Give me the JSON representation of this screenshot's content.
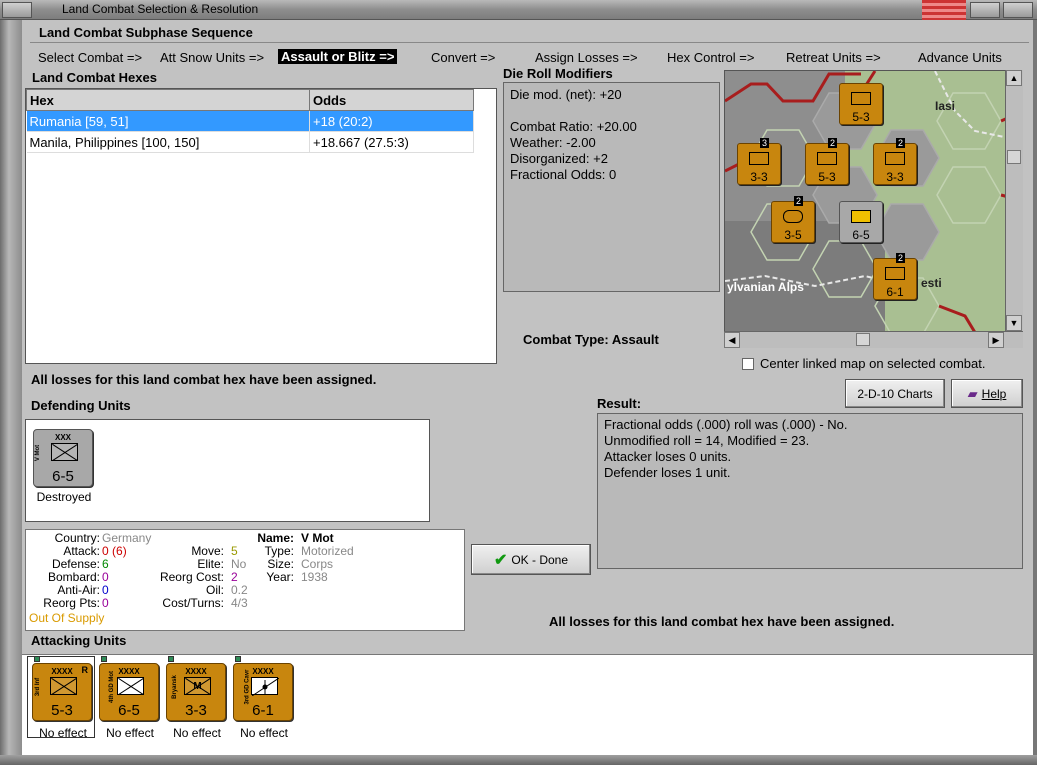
{
  "window": {
    "title": "Land Combat Selection & Resolution"
  },
  "subphase": {
    "heading": "Land Combat Subphase Sequence",
    "steps": [
      {
        "label": "Select Combat =>"
      },
      {
        "label": "Att Snow Units =>"
      },
      {
        "label": "Assault or Blitz =>"
      },
      {
        "label": "Convert =>"
      },
      {
        "label": "Assign Losses =>"
      },
      {
        "label": "Hex Control =>"
      },
      {
        "label": "Retreat Units =>"
      },
      {
        "label": "Advance Units"
      }
    ],
    "active_index": 2
  },
  "hexes": {
    "heading": "Land Combat Hexes",
    "columns": [
      "Hex",
      "Odds"
    ],
    "rows": [
      {
        "hex": "Rumania [59, 51]",
        "odds": "+18 (20:2)",
        "selected": true
      },
      {
        "hex": "Manila, Philippines [100, 150]",
        "odds": "+18.667 (27.5:3)",
        "selected": false
      }
    ]
  },
  "die_roll": {
    "heading": "Die Roll Modifiers",
    "lines": [
      "Die mod. (net): +20",
      "",
      "Combat Ratio: +20.00",
      "Weather: -2.00",
      "Disorganized: +2",
      "Fractional Odds: 0"
    ]
  },
  "combat_type": {
    "label": "Combat Type:",
    "value": "Assault"
  },
  "map": {
    "labels": [
      "Iasi",
      "ylvanian Alps",
      "esti"
    ],
    "counters": [
      {
        "value": "5-3",
        "badge": ""
      },
      {
        "value": "3-3",
        "badge": "3"
      },
      {
        "value": "5-3",
        "badge": "2"
      },
      {
        "value": "3-3",
        "badge": "2"
      },
      {
        "value": "3-5",
        "badge": "2"
      },
      {
        "value": "6-5",
        "badge": ""
      },
      {
        "value": "6-1",
        "badge": "2"
      }
    ],
    "unit_label_xx": "XX",
    "unit_label_xxxx": "XXXX"
  },
  "center_map": {
    "label": "Center linked map on selected combat.",
    "checked": false
  },
  "buttons": {
    "charts": "2-D-10 Charts",
    "help": "Help",
    "done": "OK - Done"
  },
  "status_msg": "All losses for this land combat hex have been assigned.",
  "defending": {
    "heading": "Defending Units",
    "units": [
      {
        "size": "XXX",
        "name": "V Mot",
        "value": "6-5",
        "caption": "Destroyed"
      }
    ]
  },
  "result": {
    "heading": "Result:",
    "lines": [
      "Fractional odds (.000) roll was (.000)  - No.",
      "Unmodified roll = 14, Modified = 23.",
      "Attacker loses 0 units.",
      "Defender loses 1 unit."
    ]
  },
  "unit_info": {
    "country_label": "Country:",
    "country": "Germany",
    "attack_label": "Attack:",
    "attack": "0",
    "attack_paren": "(6)",
    "defense_label": "Defense:",
    "defense": "6",
    "bombard_label": "Bombard:",
    "bombard": "0",
    "antiair_label": "Anti-Air:",
    "antiair": "0",
    "reorg_pts_label": "Reorg Pts:",
    "reorg_pts": "0",
    "supply": "Out Of Supply",
    "move_label": "Move:",
    "move": "5",
    "elite_label": "Elite:",
    "elite": "No",
    "reorg_cost_label": "Reorg Cost:",
    "reorg_cost": "2",
    "oil_label": "Oil:",
    "oil": "0.2",
    "cost_turns_label": "Cost/Turns:",
    "cost_turns": "4/3",
    "name_label": "Name:",
    "name": "V Mot",
    "type_label": "Type:",
    "type": "Motorized",
    "size_label": "Size:",
    "size": "Corps",
    "year_label": "Year:",
    "year": "1938"
  },
  "attacking": {
    "heading": "Attacking Units",
    "units": [
      {
        "size": "XXXX",
        "name": "3rd Inf",
        "value": "5-3",
        "r": "R",
        "symbol": "x",
        "caption": "No effect"
      },
      {
        "size": "XXXX",
        "name": "4th GD Mot",
        "value": "6-5",
        "r": "",
        "symbol": "x",
        "caption": "No effect"
      },
      {
        "size": "XXXX",
        "name": "Bryansk",
        "value": "3-3",
        "r": "",
        "symbol": "M",
        "caption": "No effect"
      },
      {
        "size": "XXXX",
        "name": "3rd GD Cavr",
        "value": "6-1",
        "r": "",
        "symbol": "cav",
        "caption": "No effect"
      }
    ]
  },
  "colors": {
    "counter_orange": "#c8860e",
    "selection_blue": "#3399ff",
    "attack_red": "#cc0000",
    "defense_green": "#008800",
    "bombard_purple": "#990099",
    "antiair_blue": "#0000cc",
    "supply_orange": "#d99a00",
    "move_olive": "#999900",
    "reorg_purple": "#990099",
    "grey_text": "#888888"
  }
}
